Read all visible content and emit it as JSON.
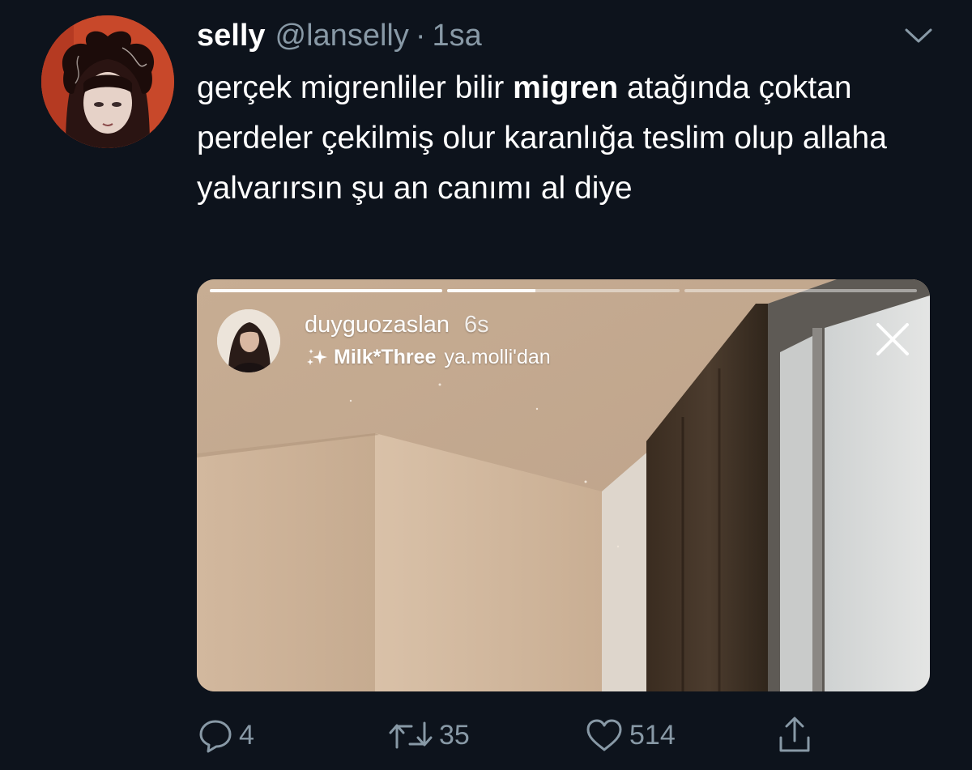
{
  "author": {
    "display_name": "selly",
    "handle": "@lanselly",
    "separator": "·",
    "time": "1sa"
  },
  "tweet": {
    "text_before": "gerçek migrenliler bilir ",
    "text_bold": "migren",
    "text_after": " atağında çoktan perdeler çekilmiş olur karanlığa teslim olup allaha yalvarırsın şu an canımı al diye"
  },
  "story": {
    "username": "duyguozaslan",
    "age": "6s",
    "effect_name": "Milk*Three",
    "effect_credit": "ya.molli'dan",
    "progress": [
      1.0,
      0.38,
      0.0
    ]
  },
  "actions": {
    "replies": "4",
    "retweets": "35",
    "likes": "514"
  },
  "colors": {
    "background": "#0d131c",
    "secondary_text": "#8899a6",
    "primary_text": "#ffffff"
  },
  "icons": [
    "chevron-down-icon",
    "sparkle-icon",
    "close-icon",
    "reply-icon",
    "retweet-icon",
    "like-icon",
    "share-icon"
  ]
}
